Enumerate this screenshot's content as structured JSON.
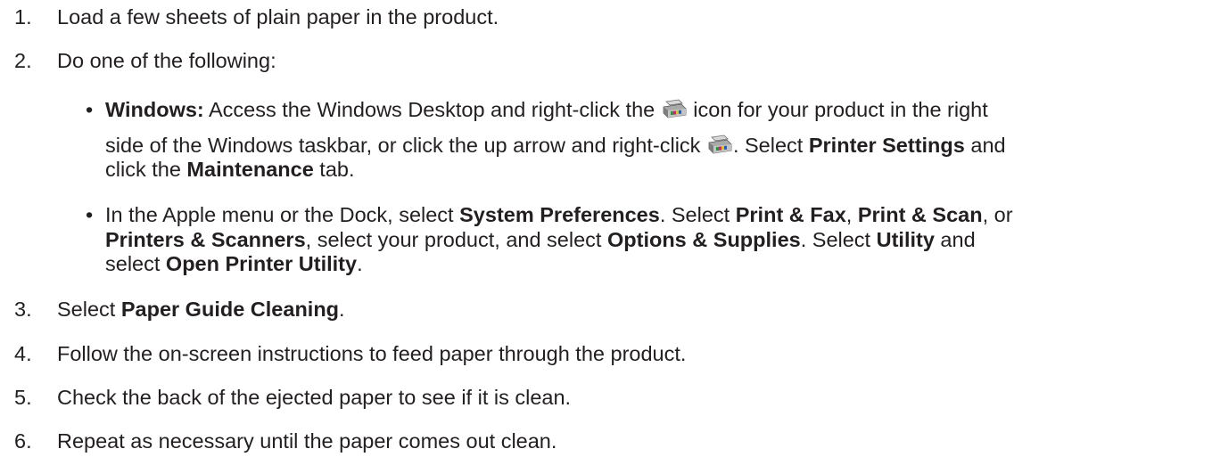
{
  "steps": [
    {
      "number": "1.",
      "text": "Load a few sheets of plain paper in the product."
    },
    {
      "number": "2.",
      "text": "Do one of the following:"
    },
    {
      "number": "3.",
      "pre": "Select ",
      "bold": "Paper Guide Cleaning",
      "post": "."
    },
    {
      "number": "4.",
      "text": "Follow the on-screen instructions to feed paper through the product."
    },
    {
      "number": "5.",
      "text": "Check the back of the ejected paper to see if it is clean."
    },
    {
      "number": "6.",
      "text": "Repeat as necessary until the paper comes out clean."
    }
  ],
  "windows": {
    "bullet": "•",
    "label": "Windows:",
    "l1a": " Access the Windows Desktop and right-click the ",
    "l1b": " icon for your product in the right",
    "l2a": "side of the Windows taskbar, or click the up arrow and right-click ",
    "l2b": ". Select ",
    "l2c": "Printer Settings",
    "l2d": " and",
    "l3a": "click the ",
    "l3b": "Maintenance",
    "l3c": " tab.",
    "icon": "printer-utility-icon"
  },
  "mac": {
    "bullet": "•",
    "l1a": "In the Apple menu or the Dock, select ",
    "l1b": "System Preferences",
    "l1c": ". Select ",
    "l1d": "Print & Fax",
    "l1e": ", ",
    "l1f": "Print & Scan",
    "l1g": ", or",
    "l2a": "Printers & Scanners",
    "l2b": ", select your product, and select ",
    "l2c": "Options & Supplies",
    "l2d": ". Select ",
    "l2e": "Utility",
    "l2f": " and",
    "l3a": "select ",
    "l3b": "Open Printer Utility",
    "l3c": "."
  }
}
